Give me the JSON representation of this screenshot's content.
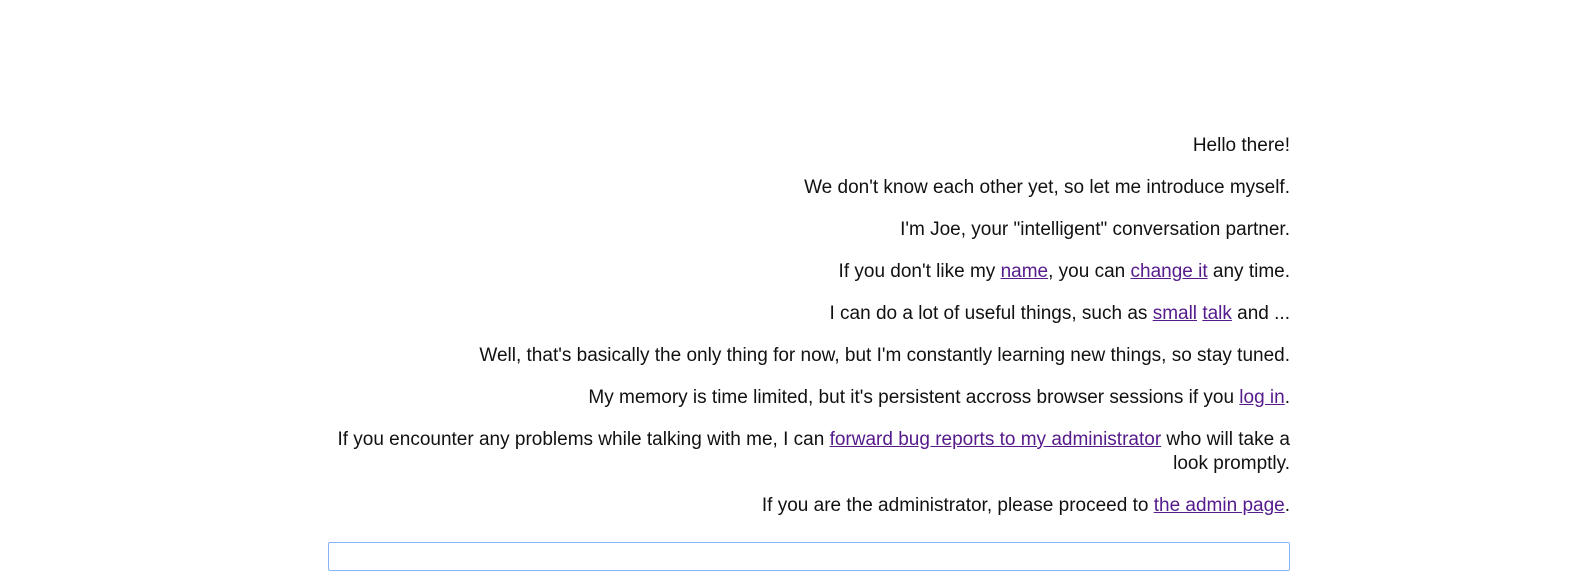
{
  "messages": {
    "m1": {
      "text": "Hello there!"
    },
    "m2": {
      "text": "We don't know each other yet, so let me introduce myself."
    },
    "m3": {
      "text": "I'm Joe, your \"intelligent\" conversation partner."
    },
    "m4": {
      "before": "If you don't like my ",
      "link_name": "name",
      "middle": ", you can ",
      "link_change": "change it",
      "after": " any time."
    },
    "m5": {
      "before": "I can do a lot of useful things, such as ",
      "link_small": "small",
      "space": " ",
      "link_talk": "talk",
      "after": " and ..."
    },
    "m6": {
      "text": "Well, that's basically the only thing for now, but I'm constantly learning new things, so stay tuned."
    },
    "m7": {
      "before": "My memory is time limited, but it's persistent accross browser sessions if you ",
      "link_login": "log in",
      "after": "."
    },
    "m8": {
      "before": "If you encounter any problems while talking with me, I can ",
      "link_bug": "forward bug reports to my administrator",
      "after": " who will take a look promptly."
    },
    "m9": {
      "before": "If you are the administrator, please proceed to ",
      "link_admin": "the admin page",
      "after": "."
    }
  },
  "input": {
    "value": "",
    "placeholder": ""
  },
  "colors": {
    "link": "#551a8b",
    "input_border": "#8ab4f8",
    "text": "#111111"
  }
}
